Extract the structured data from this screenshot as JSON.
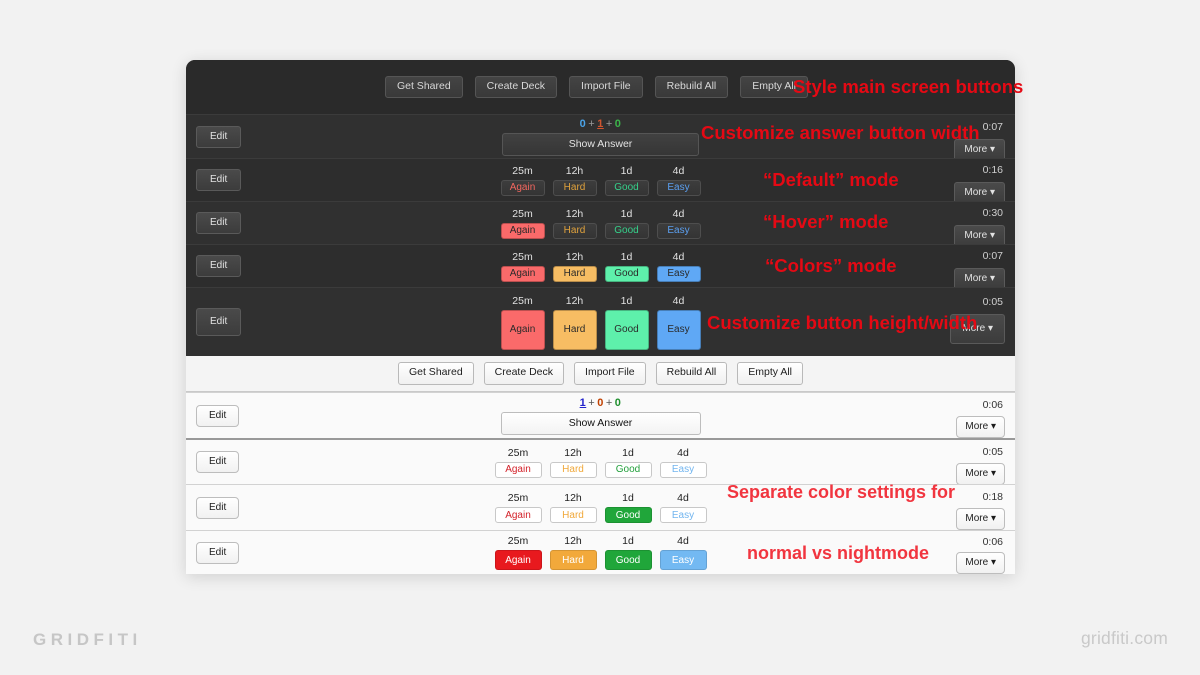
{
  "watermarks": {
    "left": "GRIDFITI",
    "right": "gridfiti.com"
  },
  "colors": {
    "annotation_dark": "#e50914",
    "annotation_light": "#f1353f",
    "again_dark": "#fa6a6a",
    "hard_dark": "#f7bd63",
    "good_dark": "#5ef0ab",
    "easy_dark": "#5fa8f5",
    "again_light": "#e8191e",
    "hard_light": "#f2a93b",
    "good_light": "#20a63a",
    "easy_light": "#73b9f2",
    "again_text_dark": "#f4675f",
    "hard_text_dark": "#e0a23c",
    "good_text_dark": "#35d08a",
    "easy_text_dark": "#5b9ff0",
    "again_text_light": "#d3222a",
    "hard_text_light": "#f0a83a",
    "good_text_light": "#23a03c",
    "easy_text_light": "#72b5ef"
  },
  "nightmode": {
    "toolbar": [
      {
        "label": "Get Shared"
      },
      {
        "label": "Create Deck"
      },
      {
        "label": "Import File"
      },
      {
        "label": "Rebuild All"
      },
      {
        "label": "Empty All"
      }
    ],
    "edit_label": "Edit",
    "more_label": "More ▾",
    "rows": [
      {
        "mode": "show-answer",
        "counts": {
          "new": "0",
          "learn": "1",
          "due": "0",
          "sep": "+"
        },
        "show_answer_label": "Show Answer",
        "timer": "0:07"
      },
      {
        "mode": "default",
        "timer": "0:16",
        "answers": [
          {
            "ivl": "25m",
            "label": "Again"
          },
          {
            "ivl": "12h",
            "label": "Hard"
          },
          {
            "ivl": "1d",
            "label": "Good"
          },
          {
            "ivl": "4d",
            "label": "Easy"
          }
        ]
      },
      {
        "mode": "hover",
        "timer": "0:30",
        "answers": [
          {
            "ivl": "25m",
            "label": "Again"
          },
          {
            "ivl": "12h",
            "label": "Hard"
          },
          {
            "ivl": "1d",
            "label": "Good"
          },
          {
            "ivl": "4d",
            "label": "Easy"
          }
        ]
      },
      {
        "mode": "colors",
        "timer": "0:07",
        "answers": [
          {
            "ivl": "25m",
            "label": "Again"
          },
          {
            "ivl": "12h",
            "label": "Hard"
          },
          {
            "ivl": "1d",
            "label": "Good"
          },
          {
            "ivl": "4d",
            "label": "Easy"
          }
        ]
      },
      {
        "mode": "big",
        "timer": "0:05",
        "answers": [
          {
            "ivl": "25m",
            "label": "Again"
          },
          {
            "ivl": "12h",
            "label": "Hard"
          },
          {
            "ivl": "1d",
            "label": "Good"
          },
          {
            "ivl": "4d",
            "label": "Easy"
          }
        ]
      }
    ],
    "annotations": [
      {
        "text": "Style main screen buttons"
      },
      {
        "text": "Customize answer button width"
      },
      {
        "text": "“Default” mode"
      },
      {
        "text": "“Hover” mode"
      },
      {
        "text": "“Colors” mode"
      },
      {
        "text": "Customize button height/width"
      }
    ]
  },
  "lightmode": {
    "toolbar": [
      {
        "label": "Get Shared"
      },
      {
        "label": "Create Deck"
      },
      {
        "label": "Import File"
      },
      {
        "label": "Rebuild All"
      },
      {
        "label": "Empty All"
      }
    ],
    "edit_label": "Edit",
    "more_label": "More ▾",
    "rows": [
      {
        "mode": "show-answer",
        "counts": {
          "new": "1",
          "learn": "0",
          "due": "0",
          "sep": "+"
        },
        "show_answer_label": "Show Answer",
        "timer": "0:06"
      },
      {
        "mode": "default",
        "timer": "0:05",
        "answers": [
          {
            "ivl": "25m",
            "label": "Again"
          },
          {
            "ivl": "12h",
            "label": "Hard"
          },
          {
            "ivl": "1d",
            "label": "Good"
          },
          {
            "ivl": "4d",
            "label": "Easy"
          }
        ]
      },
      {
        "mode": "hover",
        "timer": "0:18",
        "answers": [
          {
            "ivl": "25m",
            "label": "Again"
          },
          {
            "ivl": "12h",
            "label": "Hard"
          },
          {
            "ivl": "1d",
            "label": "Good"
          },
          {
            "ivl": "4d",
            "label": "Easy"
          }
        ]
      },
      {
        "mode": "colors",
        "timer": "0:06",
        "answers": [
          {
            "ivl": "25m",
            "label": "Again"
          },
          {
            "ivl": "12h",
            "label": "Hard"
          },
          {
            "ivl": "1d",
            "label": "Good"
          },
          {
            "ivl": "4d",
            "label": "Easy"
          }
        ]
      }
    ],
    "annotations": [
      {
        "line1": "Separate color settings for",
        "line2": "normal vs nightmode"
      }
    ]
  }
}
